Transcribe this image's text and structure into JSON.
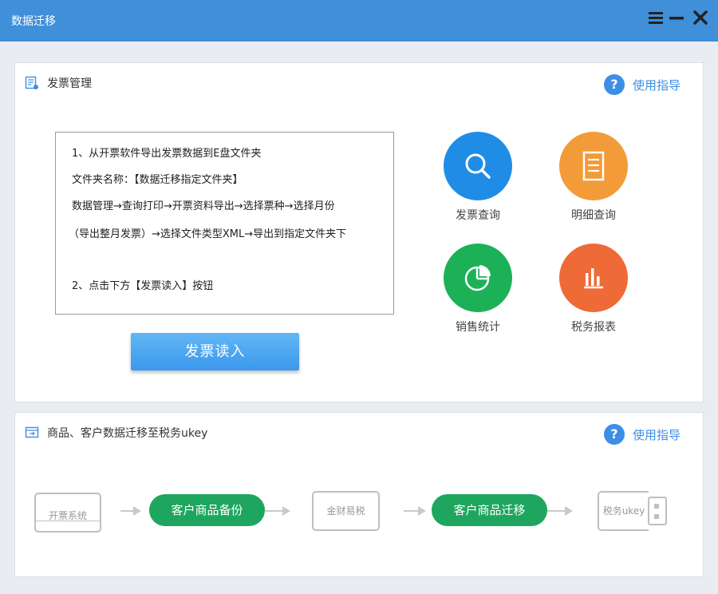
{
  "window": {
    "title": "数据迁移",
    "controls": [
      "menu-icon",
      "minimize-icon",
      "close-icon"
    ]
  },
  "invoice_panel": {
    "title": "发票管理",
    "help_label": "使用指导",
    "instructions": [
      "1、从开票软件导出发票数据到E盘文件夹",
      "文件夹名称：【数据迁移指定文件夹】",
      "数据管理→查询打印→开票资料导出→选择票种→选择月份",
      "（导出整月发票）→选择文件类型XML→导出到指定文件夹下",
      "2、点击下方【发票读入】按钮"
    ],
    "read_button": "发票读入",
    "tiles": [
      {
        "label": "发票查询",
        "icon": "search-icon",
        "color": "#1f8de6"
      },
      {
        "label": "明细查询",
        "icon": "list-icon",
        "color": "#f29b38"
      },
      {
        "label": "销售统计",
        "icon": "pie-chart-icon",
        "color": "#1db157"
      },
      {
        "label": "税务报表",
        "icon": "bar-chart-icon",
        "color": "#ee6a36"
      }
    ]
  },
  "migration_panel": {
    "title": "商品、客户数据迁移至税务ukey",
    "help_label": "使用指导",
    "flow": {
      "source_box": "开票系统",
      "backup_button": "客户商品备份",
      "middle_box": "金财易税",
      "migrate_button": "客户商品迁移",
      "target_box": "税务ukey"
    }
  },
  "colors": {
    "titlebar": "#3f8fd9",
    "accent": "#3d8ee6",
    "flow_green": "#1ea65e"
  }
}
